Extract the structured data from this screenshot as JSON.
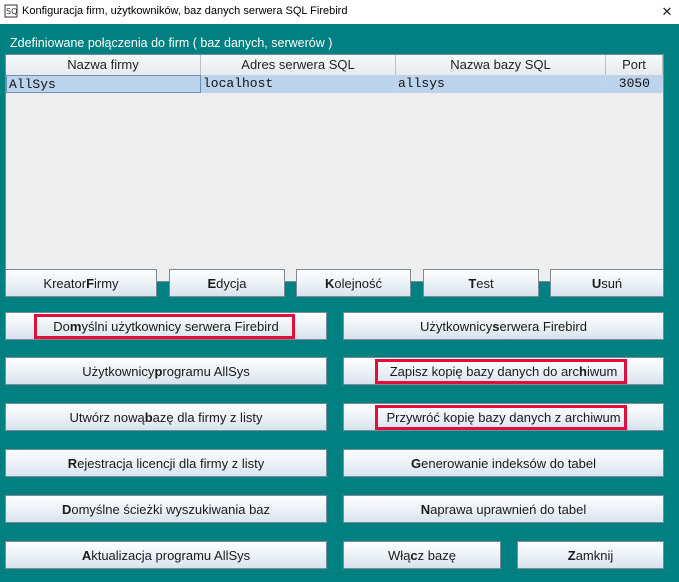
{
  "window": {
    "title": "Konfiguracja firm, użytkowników, baz danych serwera SQL Firebird",
    "close_symbol": "✕"
  },
  "group_label": "Zdefiniowane połączenia do firm ( baz danych, serwerów )",
  "table": {
    "columns": [
      "Nazwa firmy",
      "Adres serwera SQL",
      "Nazwa bazy SQL",
      "Port"
    ],
    "rows": [
      [
        "AllSys",
        "localhost",
        "allsys",
        "3050"
      ]
    ]
  },
  "buttons": {
    "kreator": {
      "pre": "Kreator ",
      "key": "F",
      "post": "irmy"
    },
    "edycja": {
      "pre": "",
      "key": "E",
      "post": "dycja"
    },
    "kolejnosc": {
      "pre": "",
      "key": "K",
      "post": "olejność"
    },
    "test": {
      "pre": "",
      "key": "T",
      "post": "est"
    },
    "usun": {
      "pre": "",
      "key": "U",
      "post": "suń"
    },
    "domyslni": {
      "pre": "Do",
      "key": "m",
      "post": "yślni użytkownicy serwera Firebird"
    },
    "uzytk_serwera": {
      "pre": "Użytkownicy ",
      "key": "s",
      "post": "erwera Firebird"
    },
    "uzytk_programu": {
      "pre": "Użytkownicy ",
      "key": "p",
      "post": "rogramu AllSys"
    },
    "zapisz": {
      "pre": "Zapisz kopię bazy danych do arc",
      "key": "h",
      "post": "iwum"
    },
    "utworz": {
      "pre": "Utwórz nową ",
      "key": "b",
      "post": "azę dla firmy z listy"
    },
    "przywroc": {
      "pre": "Przywróć kopię bazy danych z archiwum",
      "key": "",
      "post": ""
    },
    "rejestracja": {
      "pre": "",
      "key": "R",
      "post": "ejestracja licencji dla firmy z listy"
    },
    "generowanie": {
      "pre": "",
      "key": "G",
      "post": "enerowanie indeksów do tabel"
    },
    "sciezki": {
      "pre": "",
      "key": "D",
      "post": "omyślne ścieżki wyszukiwania baz"
    },
    "naprawa": {
      "pre": "",
      "key": "N",
      "post": "aprawa uprawnień do tabel"
    },
    "aktualizacja": {
      "pre": "",
      "key": "A",
      "post": "ktualizacja programu AllSys"
    },
    "wlacz": {
      "pre": "Włą",
      "key": "c",
      "post": "z bazę"
    },
    "zamknij": {
      "pre": "",
      "key": "Z",
      "post": "amknij"
    }
  },
  "colors": {
    "background": "#008080",
    "highlight": "#e0103a",
    "selected_row": "#bcd3ec"
  }
}
